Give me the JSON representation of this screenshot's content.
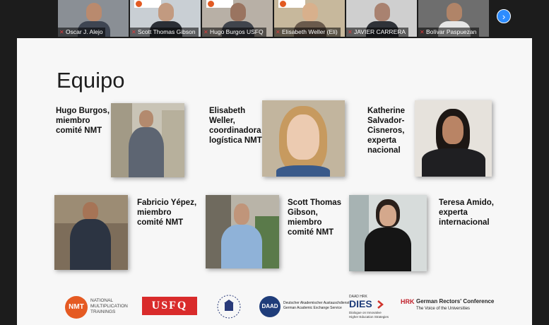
{
  "video_strip": {
    "participants": [
      {
        "name": "Oscar J. Alejo"
      },
      {
        "name": "Scott Thomas Gibson"
      },
      {
        "name": "Hugo Burgos USFQ"
      },
      {
        "name": "Elisabeth Weller (Eli)"
      },
      {
        "name": "JAVIER CARRERA"
      },
      {
        "name": "Bolívar Paspuezan"
      }
    ],
    "next_icon": "chevron-right-icon"
  },
  "slide": {
    "title": "Equipo",
    "members": [
      {
        "line1": "Hugo Burgos,",
        "line2": "miembro",
        "line3": "comité NMT"
      },
      {
        "line1": "Elisabeth",
        "line2": "Weller,",
        "line3": "coordinadora",
        "line4": "logística NMT"
      },
      {
        "line1": "Katherine",
        "line2": "Salvador-",
        "line3": "Cisneros,",
        "line4": "experta",
        "line5": "nacional"
      },
      {
        "line1": "Fabricio Yépez,",
        "line2": "miembro",
        "line3": "comité NMT"
      },
      {
        "line1": "Scott Thomas",
        "line2": "Gibson,",
        "line3": "miembro",
        "line4": "comité NMT"
      },
      {
        "line1": "Teresa Amido,",
        "line2": "experta",
        "line3": "internacional"
      }
    ],
    "logos": {
      "nmt_mark": "NMT",
      "nmt_line1": "NATIONAL",
      "nmt_line2": "MULTIPLICATION",
      "nmt_line3": "TRAININGS",
      "usfq": "USFQ",
      "daad_mark": "DAAD",
      "daad_line1": "Deutscher Akademischer Austauschdienst",
      "daad_line2": "German Academic Exchange Service",
      "dies_small": "DAAD HRK",
      "dies_mark": "DIES",
      "dies_line1": "Dialogue on Innovative",
      "dies_line2": "Higher Education Strategies",
      "hrk_mark": "HRK",
      "hrk_line1": "German Rectors' Conference",
      "hrk_line2": "The Voice of the Universities"
    }
  }
}
